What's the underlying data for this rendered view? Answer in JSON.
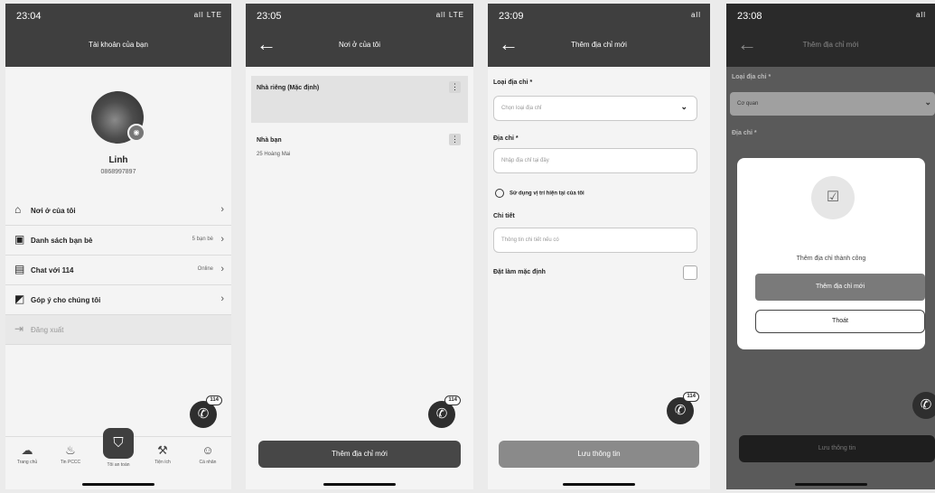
{
  "screen1": {
    "time": "23:04",
    "signal": "all LTE",
    "title": "Tài khoản của bạn",
    "user_name": "Linh",
    "user_phone": "0868997897",
    "menu": [
      {
        "icon": "home-icon",
        "glyph": "⌂",
        "label": "Nơi ở của tôi",
        "right": ""
      },
      {
        "icon": "contacts-icon",
        "glyph": "▣",
        "label": "Danh sách bạn bè",
        "right": "5 bạn bè"
      },
      {
        "icon": "chat-icon",
        "glyph": "▤",
        "label": "Chat với 114",
        "right": "Online"
      },
      {
        "icon": "feedback-icon",
        "glyph": "◩",
        "label": "Góp ý cho chúng tôi",
        "right": ""
      }
    ],
    "logout_label": "Đăng xuất",
    "tabs": [
      {
        "label": "Trang chủ",
        "glyph": "☁"
      },
      {
        "label": "Tin PCCC",
        "glyph": "♨"
      },
      {
        "label": "Tiện ích",
        "glyph": "⚒"
      },
      {
        "label": "Cá nhân",
        "glyph": "☺"
      }
    ],
    "center_tab_label": "Tôi an toàn",
    "fab_badge": "114"
  },
  "screen2": {
    "time": "23:05",
    "signal": "all LTE",
    "title": "Nơi ở của tôi",
    "addresses": [
      {
        "name": "Nhà riêng (Mặc định)",
        "address": ""
      },
      {
        "name": "Nhà bạn",
        "address": "25 Hoàng Mai"
      }
    ],
    "add_button": "Thêm địa chỉ mới",
    "fab_badge": "114"
  },
  "screen3": {
    "time": "23:09",
    "signal": "all",
    "title": "Thêm địa chỉ mới",
    "type_label": "Loại địa chỉ *",
    "type_placeholder": "Chọn loại địa chỉ",
    "address_label": "Địa chỉ *",
    "address_placeholder": "Nhập địa chỉ tại đây",
    "use_location": "Sử dụng vị trí hiện tại của tôi",
    "detail_label": "Chi tiết",
    "detail_placeholder": "Thông tin chi tiết nếu có",
    "default_label": "Đặt làm mặc định",
    "save_button": "Lưu thông tin",
    "fab_badge": "114"
  },
  "screen4": {
    "time": "23:08",
    "signal": "all",
    "title": "Thêm địa chỉ mới",
    "type_label": "Loại địa chỉ *",
    "type_value": "Cơ quan",
    "address_label": "Địa chỉ *",
    "success_message": "Thêm địa chỉ thành công",
    "add_more_button": "Thêm địa chỉ mới",
    "exit_button": "Thoát",
    "save_button": "Lưu thông tin"
  }
}
